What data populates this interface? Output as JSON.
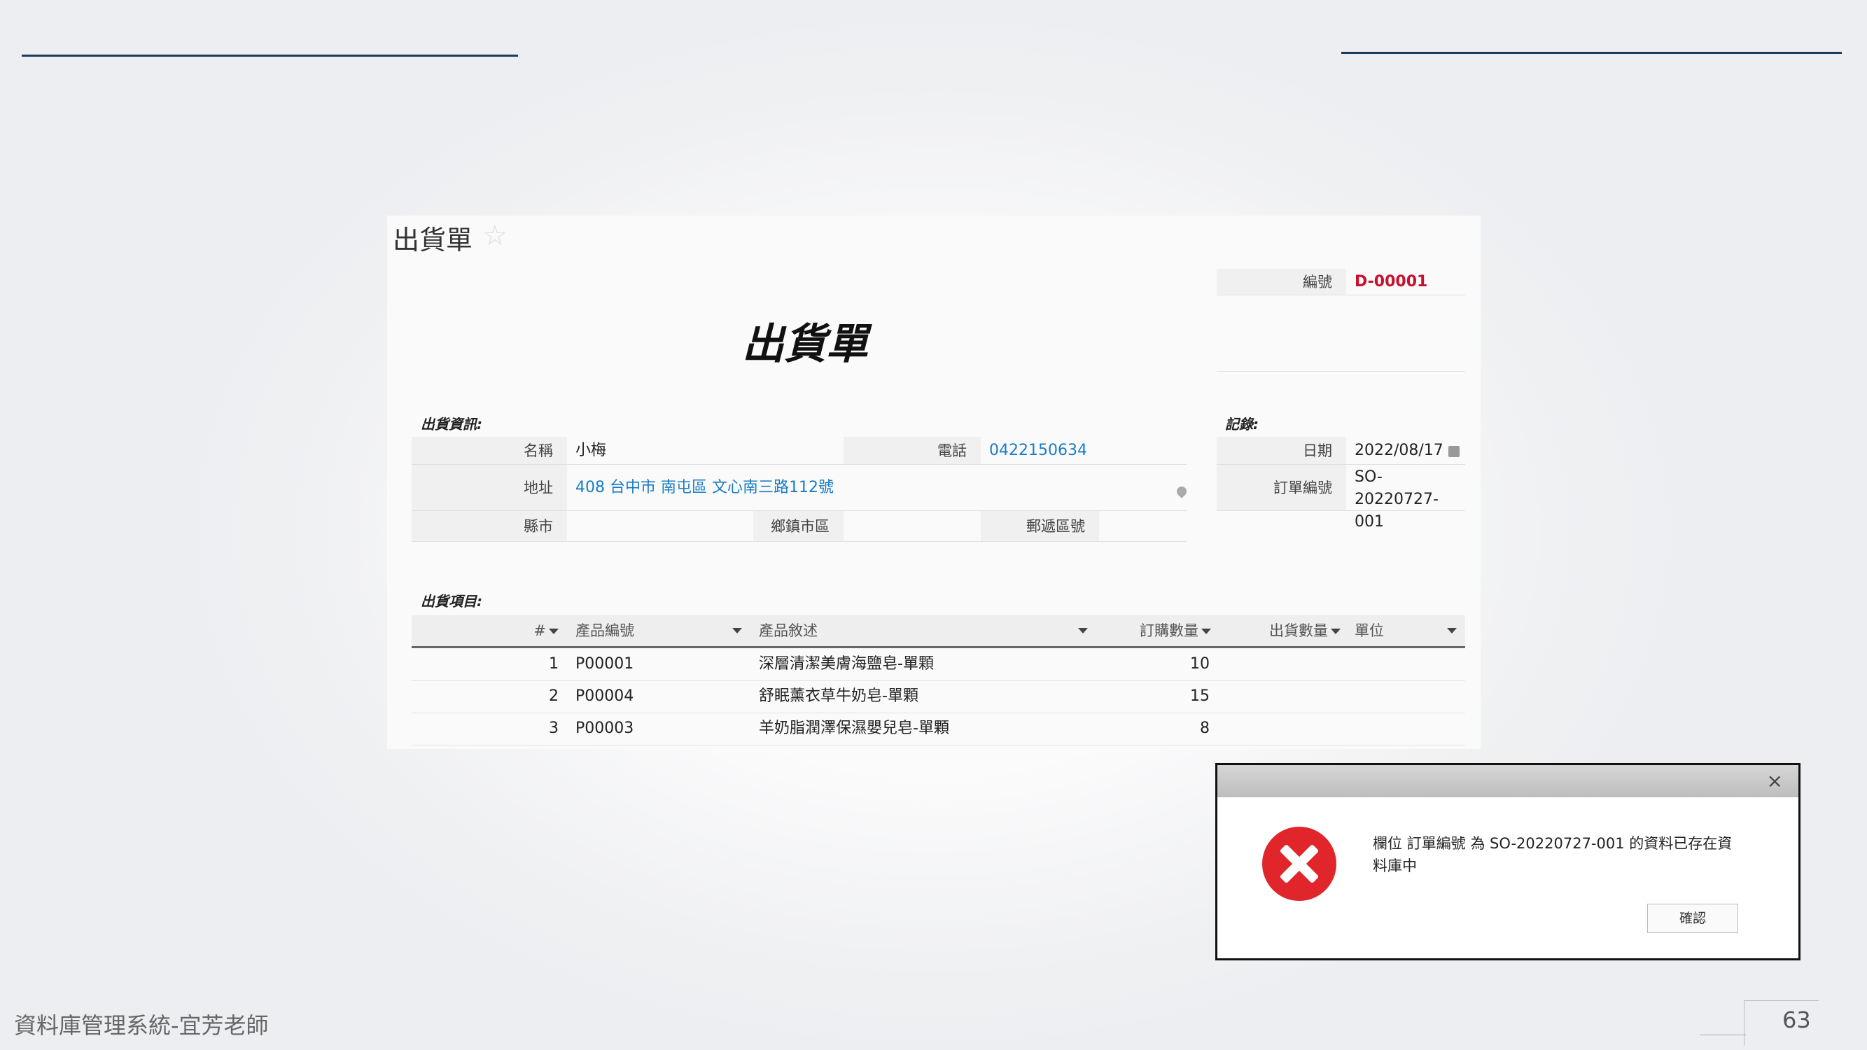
{
  "form": {
    "title": "出貨單",
    "big_title": "出貨單",
    "number_label": "編號",
    "number_value": "D-00001",
    "shipping_section": "出貨資訊:",
    "records_section": "記錄:",
    "fields": {
      "name_label": "名稱",
      "name_value": "小梅",
      "phone_label": "電話",
      "phone_value": "0422150634",
      "address_label": "地址",
      "address_value": "408 台中市 南屯區 文心南三路112號",
      "county_label": "縣市",
      "county_value": "",
      "town_label": "鄉鎮市區",
      "town_value": "",
      "zip_label": "郵遞區號",
      "zip_value": "",
      "date_label": "日期",
      "date_value": "2022/08/17",
      "order_no_label": "訂單編號",
      "order_no_value_line1": "SO-20220727-",
      "order_no_value_line2": "001"
    },
    "items_section": "出貨項目:",
    "columns": [
      "#",
      "產品編號",
      "產品敘述",
      "訂購數量",
      "出貨數量",
      "單位"
    ],
    "rows": [
      {
        "no": "1",
        "code": "P00001",
        "desc": "深層清潔美膚海鹽皂-單顆",
        "qty": "10",
        "shipped": "",
        "unit": ""
      },
      {
        "no": "2",
        "code": "P00004",
        "desc": "舒眠薰衣草牛奶皂-單顆",
        "qty": "15",
        "shipped": "",
        "unit": ""
      },
      {
        "no": "3",
        "code": "P00003",
        "desc": "羊奶脂潤澤保濕嬰兒皂-單顆",
        "qty": "8",
        "shipped": "",
        "unit": ""
      }
    ]
  },
  "dialog": {
    "close": "×",
    "message": "欄位 訂單編號 為 SO-20220727-001 的資料已存在資料庫中",
    "confirm": "確認",
    "icon": "error-icon",
    "color": "#e0252b"
  },
  "footer": {
    "course": "資料庫管理系統-宜芳老師",
    "page": "63"
  }
}
